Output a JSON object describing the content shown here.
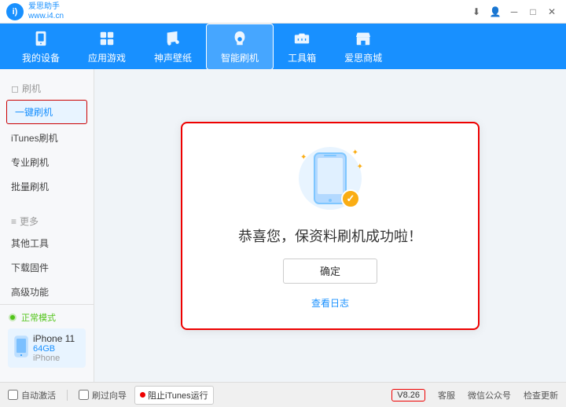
{
  "app": {
    "logo_text": "爱思助手",
    "logo_subtext": "www.i4.cn"
  },
  "titlebar": {
    "controls": [
      "minimize",
      "maximize",
      "close"
    ],
    "right_icons": [
      "download-icon",
      "user-icon"
    ]
  },
  "topnav": {
    "items": [
      {
        "id": "my-device",
        "label": "我的设备",
        "icon": "device"
      },
      {
        "id": "apps-games",
        "label": "应用游戏",
        "icon": "apps"
      },
      {
        "id": "ringtones",
        "label": "神声壁纸",
        "icon": "ringtone"
      },
      {
        "id": "smart-flash",
        "label": "智能刷机",
        "icon": "flash",
        "active": true
      },
      {
        "id": "toolbox",
        "label": "工具箱",
        "icon": "tools"
      },
      {
        "id": "store",
        "label": "爱思商城",
        "icon": "store"
      }
    ]
  },
  "sidebar": {
    "section_flash": "刷机",
    "items": [
      {
        "id": "one-key-flash",
        "label": "一键刷机",
        "active": true
      },
      {
        "id": "itunes-flash",
        "label": "iTunes刷机"
      },
      {
        "id": "pro-flash",
        "label": "专业刷机"
      },
      {
        "id": "batch-flash",
        "label": "批量刷机"
      }
    ],
    "section_more": "更多",
    "more_items": [
      {
        "id": "other-tools",
        "label": "其他工具"
      },
      {
        "id": "download-firmware",
        "label": "下载固件"
      },
      {
        "id": "advanced",
        "label": "高级功能"
      }
    ]
  },
  "device": {
    "mode_label": "正常模式",
    "name": "iPhone 11",
    "capacity": "64GB",
    "model": "iPhone"
  },
  "success_dialog": {
    "title": "恭喜您，保资料刷机成功啦！",
    "confirm_btn": "确定",
    "view_log_link": "查看日志"
  },
  "bottombar": {
    "auto_activate_label": "自动激活",
    "redirect_label": "刷过向导",
    "itunes_stop_label": "阻止iTunes运行",
    "version": "V8.26",
    "support_label": "客服",
    "wechat_label": "微信公众号",
    "check_update_label": "检查更新"
  }
}
